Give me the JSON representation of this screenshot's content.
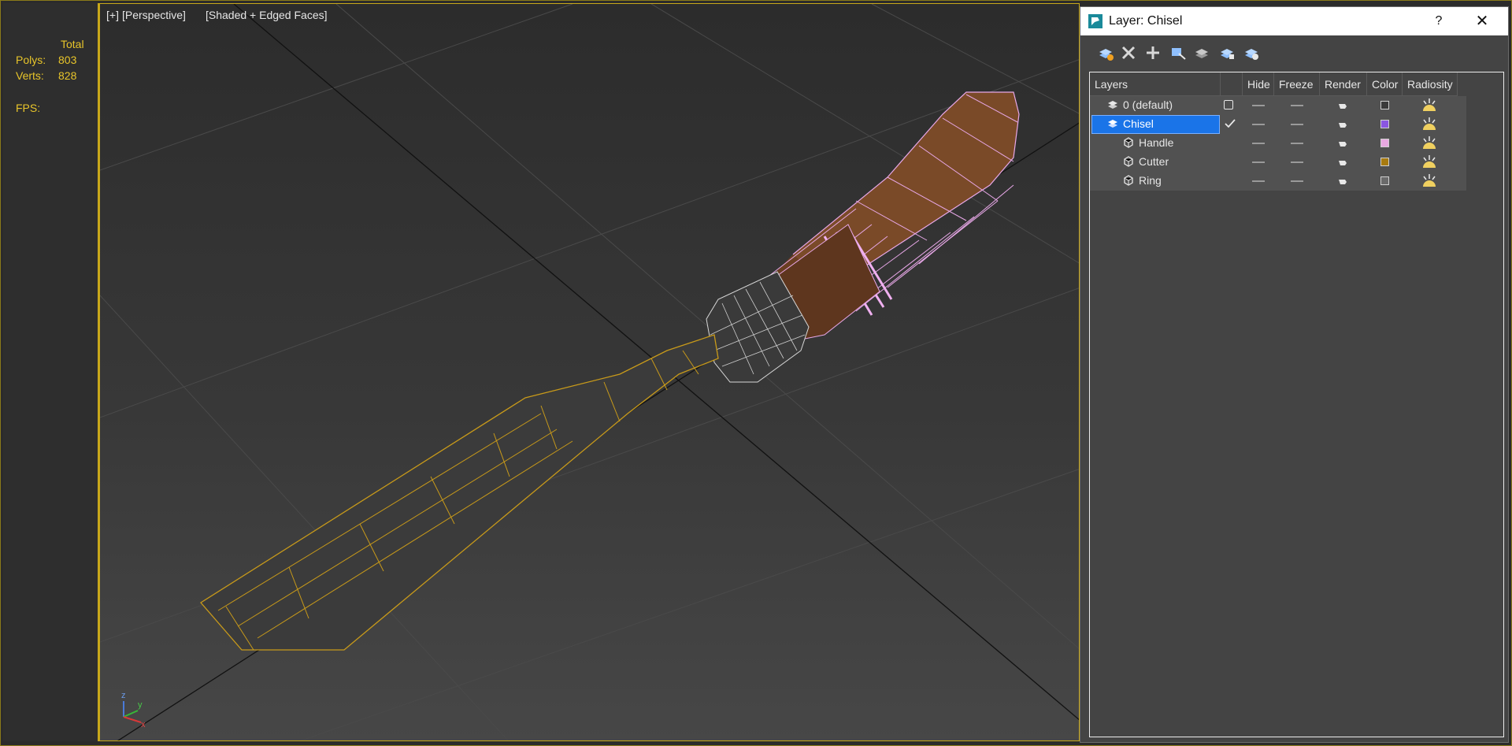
{
  "stats": {
    "total_label": "Total",
    "polys_label": "Polys:",
    "polys_value": "803",
    "verts_label": "Verts:",
    "verts_value": "828",
    "fps_label": "FPS:"
  },
  "viewport": {
    "label_plus": "[+]",
    "label_view": "[Perspective]",
    "label_shading": "[Shaded + Edged Faces]",
    "axis_labels": {
      "z": "z",
      "y": "y",
      "x": "x"
    }
  },
  "dialog": {
    "title": "Layer: Chisel",
    "help": "?",
    "close": "✕",
    "toolbar": [
      "new-layer-icon",
      "delete-layer-icon",
      "add-selection-icon",
      "select-objects-icon",
      "highlight-selected-icon",
      "hide-all-icon",
      "freeze-all-icon"
    ],
    "columns": {
      "layers": "Layers",
      "hide": "Hide",
      "freeze": "Freeze",
      "render": "Render",
      "color": "Color",
      "radiosity": "Radiosity"
    },
    "rows": [
      {
        "name": "0 (default)",
        "type": "layer",
        "color": "#3a3a3a",
        "active_box": true,
        "selected": false
      },
      {
        "name": "Chisel",
        "type": "layer",
        "color": "#8a56e0",
        "current": true,
        "selected": true
      },
      {
        "name": "Handle",
        "type": "object",
        "color": "#e8a8e0",
        "selected": false
      },
      {
        "name": "Cutter",
        "type": "object",
        "color": "#a87b10",
        "selected": false
      },
      {
        "name": "Ring",
        "type": "object",
        "color": "#6a6a6a",
        "selected": false
      }
    ]
  }
}
